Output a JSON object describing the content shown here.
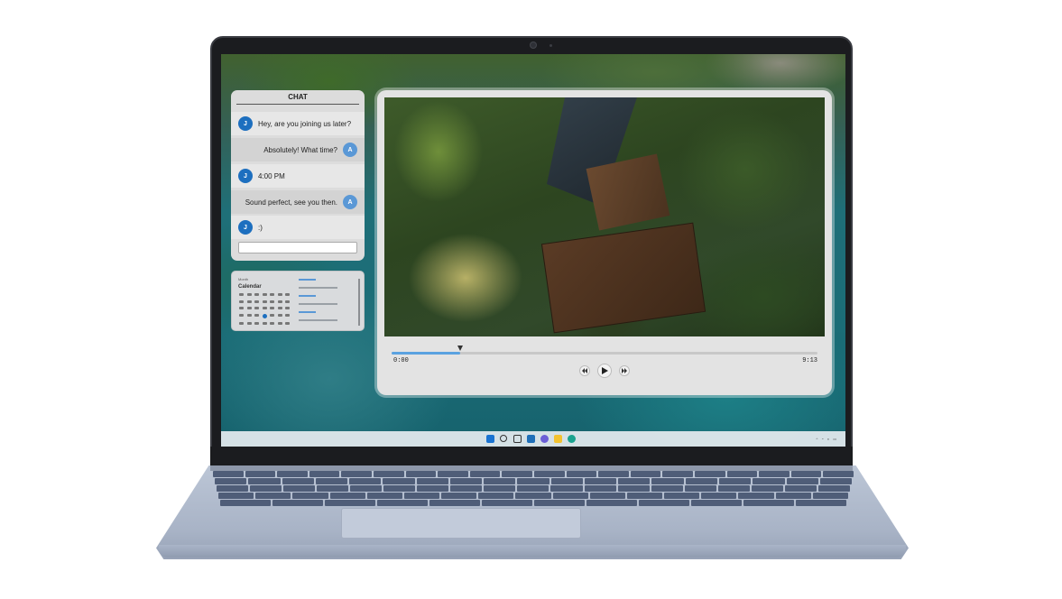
{
  "chat": {
    "title": "CHAT",
    "messages": [
      {
        "sender": "J",
        "direction": "incoming",
        "text": "Hey, are you joining us later?"
      },
      {
        "sender": "A",
        "direction": "outgoing",
        "text": "Absolutely! What time?"
      },
      {
        "sender": "J",
        "direction": "incoming",
        "text": "4:00 PM"
      },
      {
        "sender": "A",
        "direction": "outgoing",
        "text": "Sound perfect, see you then."
      },
      {
        "sender": "J",
        "direction": "incoming",
        "text": ":)"
      }
    ],
    "input_value": ""
  },
  "calendar_widget": {
    "tab_label": "Month",
    "heading": "Calendar"
  },
  "player": {
    "time_current": "0:00",
    "time_total": "9:13",
    "progress_fraction": 0.16
  },
  "taskbar": {
    "icons": [
      "windows-start-icon",
      "search-icon",
      "task-view-icon",
      "widgets-icon",
      "chat-app-icon",
      "file-explorer-icon",
      "edge-browser-icon"
    ],
    "tray_time": "",
    "tray_date": ""
  },
  "colors": {
    "accent_blue": "#1d6fbf",
    "avatar_a": "#5a98d6",
    "progress": "#5aa2e0"
  }
}
